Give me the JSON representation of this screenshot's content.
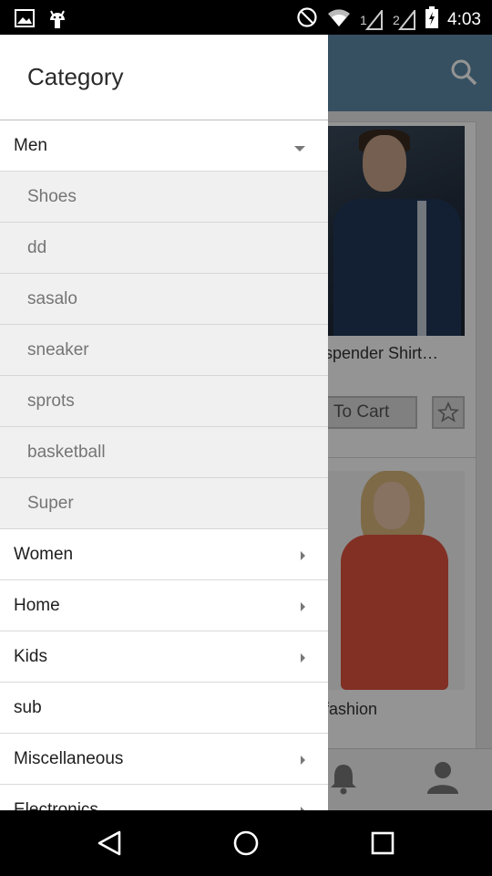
{
  "status_bar": {
    "time": "4:03",
    "sim1_label": "1",
    "sim2_label": "2",
    "icons": [
      "image-icon",
      "android-icon",
      "do-not-disturb-icon",
      "wifi-icon",
      "signal-icon",
      "battery-charging-icon"
    ]
  },
  "drawer": {
    "title": "Category",
    "categories": [
      {
        "label": "Men",
        "expanded": true,
        "subcategories": [
          "Shoes",
          "dd",
          "sasalo",
          "sneaker",
          "sprots",
          "basketball",
          "Super"
        ]
      },
      {
        "label": "Women",
        "expanded": false
      },
      {
        "label": "Home",
        "expanded": false
      },
      {
        "label": "Kids",
        "expanded": false
      },
      {
        "label": "sub",
        "expanded": false
      },
      {
        "label": "Miscellaneous",
        "expanded": false
      },
      {
        "label": "Electronics",
        "expanded": false
      }
    ]
  },
  "background_app": {
    "product1_title": "spender Shirt…",
    "add_to_cart_label": "To Cart",
    "product2_title": "fashion",
    "colors": {
      "toolbar": "#5d8aa8",
      "scrim": "rgba(0,0,0,0.42)"
    }
  },
  "nav_bar": {
    "icons": [
      "back-icon",
      "home-icon",
      "recents-icon"
    ]
  }
}
